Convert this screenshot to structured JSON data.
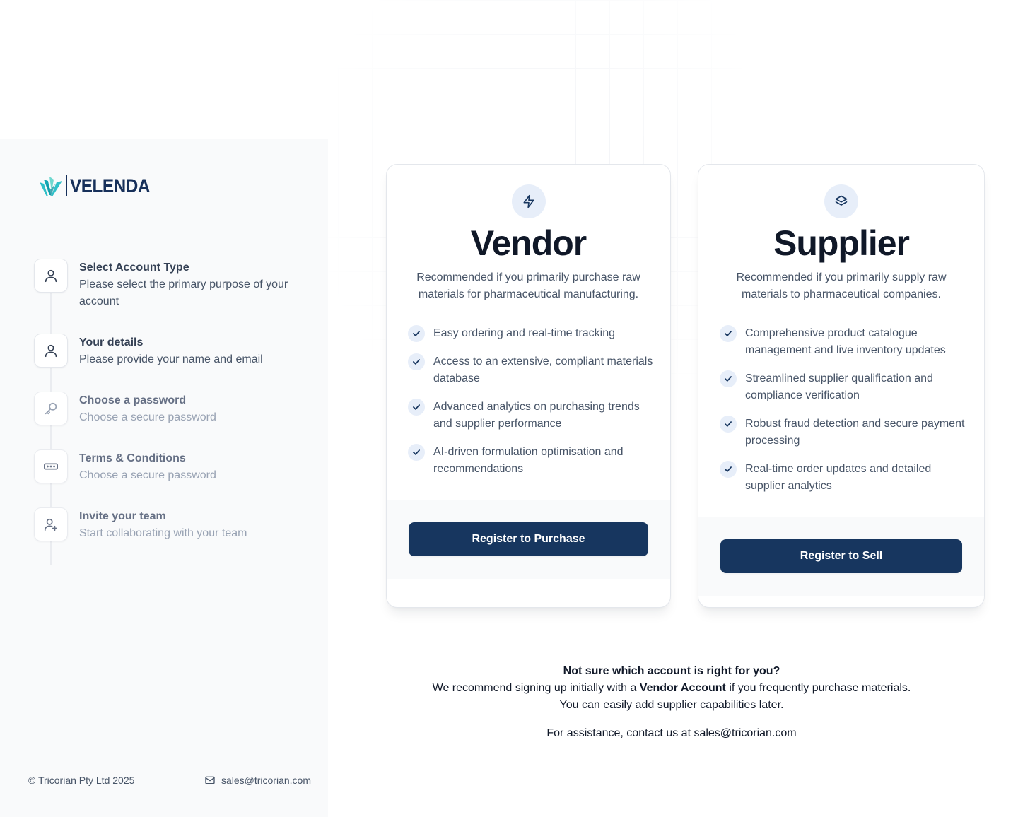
{
  "brand": {
    "name": "VELENDA"
  },
  "steps": [
    {
      "title": "Select Account Type",
      "desc": "Please select the primary purpose of your account",
      "icon": "user-icon"
    },
    {
      "title": "Your details",
      "desc": "Please provide your name and email",
      "icon": "user-icon"
    },
    {
      "title": "Choose a password",
      "desc": "Choose a secure password",
      "icon": "key-icon"
    },
    {
      "title": "Terms & Conditions",
      "desc": "Choose a secure password",
      "icon": "password-dots-icon"
    },
    {
      "title": "Invite your team",
      "desc": "Start collaborating with your team",
      "icon": "user-plus-icon"
    }
  ],
  "footer": {
    "copyright": "© Tricorian Pty Ltd 2025",
    "email": "sales@tricorian.com"
  },
  "vendor": {
    "icon": "lightning-icon",
    "title": "Vendor",
    "subtitle": "Recommended if you primarily purchase raw materials for pharmaceutical manufacturing.",
    "features": [
      "Easy ordering and real-time tracking",
      "Access to an extensive, compliant materials database",
      "Advanced analytics on purchasing trends and supplier performance",
      "AI-driven formulation optimisation and recommendations"
    ],
    "cta": "Register to Purchase"
  },
  "supplier": {
    "icon": "layers-icon",
    "title": "Supplier",
    "subtitle": "Recommended if you primarily supply raw materials to pharmaceutical companies.",
    "features": [
      "Comprehensive product catalogue management and live inventory updates",
      "Streamlined supplier qualification and compliance verification",
      "Robust fraud detection and secure payment processing",
      "Real-time order updates and detailed supplier analytics"
    ],
    "cta": "Register to Sell"
  },
  "note": {
    "question": "Not sure which account is right for you?",
    "line_pre": "We recommend signing up initially with a ",
    "line_bold": "Vendor Account",
    "line_post": " if you frequently purchase materials. You can easily add supplier capabilities later.",
    "assist": "For assistance, contact us at sales@tricorian.com"
  },
  "colors": {
    "primary": "#17365f",
    "badge": "#e7eef9",
    "sidebar": "#f9fafb"
  }
}
